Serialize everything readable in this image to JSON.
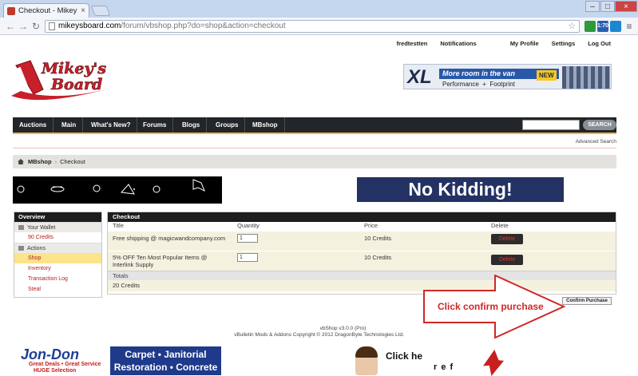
{
  "browser": {
    "tab_title": "Checkout - Mikey's Board",
    "tab_close": "×",
    "url_host": "mikeysboard.com",
    "url_path": "/forum/vbshop.php?do=shop&action=checkout",
    "back": "←",
    "forward": "→",
    "reload": "↻",
    "bookmark_star": "☆",
    "ext_badge": "1:70",
    "window_min": "–",
    "window_max": "□",
    "window_close": "×"
  },
  "userbar": {
    "username": "fredtestten",
    "notifications": "Notifications",
    "profile": "My Profile",
    "settings": "Settings",
    "logout": "Log Out"
  },
  "logo": {
    "line1": "Mikey's",
    "line2": "Board"
  },
  "top_ad": {
    "brand": "XL",
    "tagline": "More room in the van",
    "badge": "NEW",
    "sub_left": "Performance",
    "sub_mid": "Footprint"
  },
  "navbar": {
    "items": [
      "Auctions",
      "Main",
      "What's New?",
      "Forums",
      "Blogs",
      "Groups",
      "MBshop"
    ],
    "search_button": "SEARCH"
  },
  "advanced_search": "Advanced Search",
  "breadcrumb": {
    "root": "MBshop",
    "current": "Checkout"
  },
  "banner": {
    "text": "No Kidding!"
  },
  "sidebar": {
    "header": "Overview",
    "wallet_section": "Your Wallet",
    "credits": "90 Credits",
    "actions_section": "Actions",
    "links": [
      "Shop",
      "Inventory",
      "Transaction Log",
      "Steal"
    ]
  },
  "checkout": {
    "header": "Checkout",
    "columns": {
      "title": "Title",
      "quantity": "Quantity",
      "price": "Price",
      "delete": "Delete"
    },
    "rows": [
      {
        "title": "Free shipping @ magicwandcompany.com",
        "quantity": "1",
        "price": "10 Credits",
        "delete": "Delete"
      },
      {
        "title_line1": "5% OFF Ten Most Popular Items @",
        "title_line2": "Interlink Supply",
        "quantity": "1",
        "price": "10 Credits",
        "delete": "Delete"
      }
    ],
    "totals_label": "Totals",
    "total_value": "20 Credits",
    "confirm_button": "Confirm Purchase"
  },
  "annotation": {
    "text": "Click confirm purchase"
  },
  "footer": {
    "line1": "vbShop v3.0.0 (Pro)",
    "line2": "vBulletin Mods & Addons Copyright © 2012 DragonByte Technologies Ltd."
  },
  "bottom_ads": {
    "jondon_name": "Jon-Don",
    "jondon_sub1": "Great Deals • Great Service",
    "jondon_sub2": "HUGE Selection",
    "carpet_line1": "Carpet • Janitorial",
    "carpet_line2": "Restoration • Concrete",
    "clickhere": "Click he",
    "clickhere_ref": "r e f"
  },
  "colors": {
    "navbar_bg": "#222529",
    "navbar_accent": "#e8b74b",
    "sidebar_active": "#fbe48a",
    "link_red": "#b02222",
    "annotation_red": "#d12727",
    "banner_navy": "#243163"
  }
}
